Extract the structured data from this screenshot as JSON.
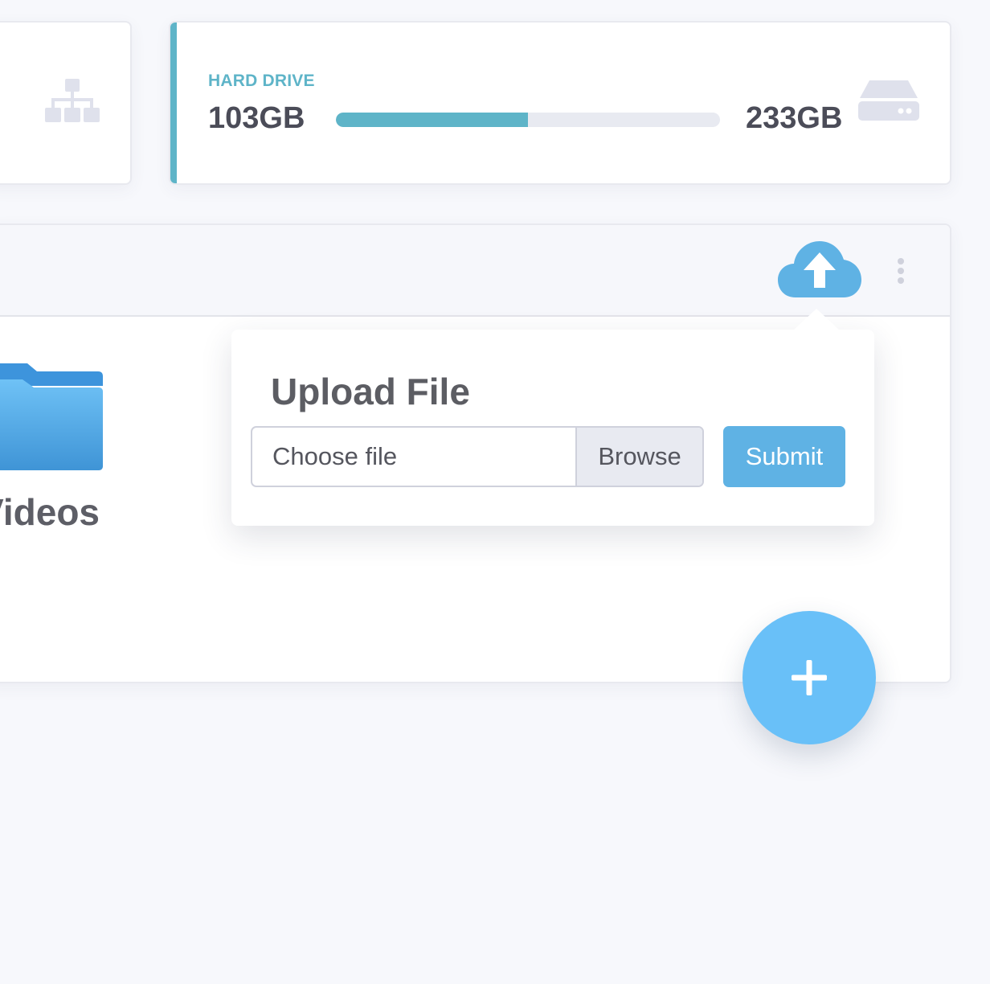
{
  "storage": {
    "label": "HARD DRIVE",
    "used": "103GB",
    "total": "233GB",
    "used_fraction": 0.5
  },
  "files": {
    "folders": [
      {
        "label": "Videos",
        "icon": "folder-icon"
      }
    ]
  },
  "upload_popover": {
    "title": "Upload File",
    "file_placeholder": "Choose file",
    "browse_label": "Browse",
    "submit_label": "Submit"
  },
  "icons": {
    "network": "sitemap-icon",
    "hard_drive": "hard-drive-icon",
    "upload": "cloud-upload-icon",
    "menu": "kebab-menu-icon",
    "fab": "plus-icon"
  },
  "colors": {
    "accent_teal": "#5eb4c8",
    "primary_blue": "#5fb2e4",
    "fab_blue": "#69c0f8",
    "folder_blue": "#4fa8ec"
  }
}
